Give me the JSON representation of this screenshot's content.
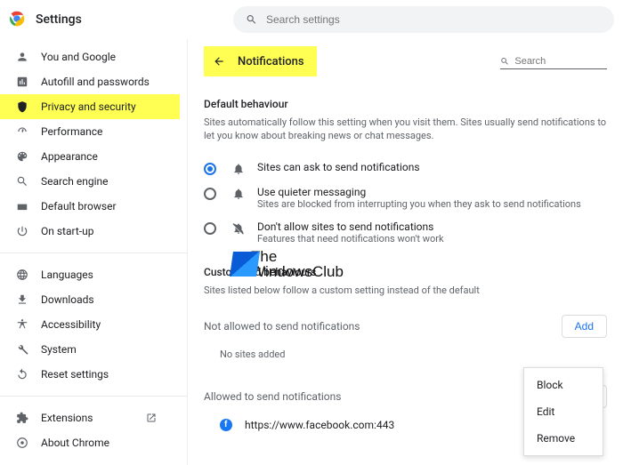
{
  "header": {
    "title": "Settings",
    "search_placeholder": "Search settings"
  },
  "sidebar": {
    "items": [
      {
        "icon": "person",
        "label": "You and Google"
      },
      {
        "icon": "autofill",
        "label": "Autofill and passwords"
      },
      {
        "icon": "security",
        "label": "Privacy and security"
      },
      {
        "icon": "perf",
        "label": "Performance"
      },
      {
        "icon": "appearance",
        "label": "Appearance"
      },
      {
        "icon": "search",
        "label": "Search engine"
      },
      {
        "icon": "browser",
        "label": "Default browser"
      },
      {
        "icon": "power",
        "label": "On start-up"
      }
    ],
    "group2": [
      {
        "icon": "globe",
        "label": "Languages"
      },
      {
        "icon": "download",
        "label": "Downloads"
      },
      {
        "icon": "access",
        "label": "Accessibility"
      },
      {
        "icon": "system",
        "label": "System"
      },
      {
        "icon": "reset",
        "label": "Reset settings"
      }
    ],
    "group3": [
      {
        "icon": "ext",
        "label": "Extensions"
      },
      {
        "icon": "about",
        "label": "About Chrome"
      }
    ]
  },
  "page": {
    "title": "Notifications",
    "search_placeholder": "Search"
  },
  "default_behaviour": {
    "title": "Default behaviour",
    "desc": "Sites automatically follow this setting when you visit them. Sites usually send notifications to let you know about breaking news or chat messages.",
    "options": [
      {
        "primary": "Sites can ask to send notifications",
        "secondary": ""
      },
      {
        "primary": "Use quieter messaging",
        "secondary": "Sites are blocked from interrupting you when they ask to send notifications"
      },
      {
        "primary": "Don't allow sites to send notifications",
        "secondary": "Features that need notifications won't work"
      }
    ]
  },
  "custom": {
    "title": "Customised behaviours",
    "desc": "Sites listed below follow a custom setting instead of the default",
    "not_allowed_label": "Not allowed to send notifications",
    "add_label": "Add",
    "empty": "No sites added",
    "allowed_label": "Allowed to send notifications",
    "site1": "https://www.facebook.com:443"
  },
  "menu": {
    "block": "Block",
    "edit": "Edit",
    "remove": "Remove"
  },
  "watermark": {
    "line1": "The",
    "line2": "WindowsClub"
  }
}
